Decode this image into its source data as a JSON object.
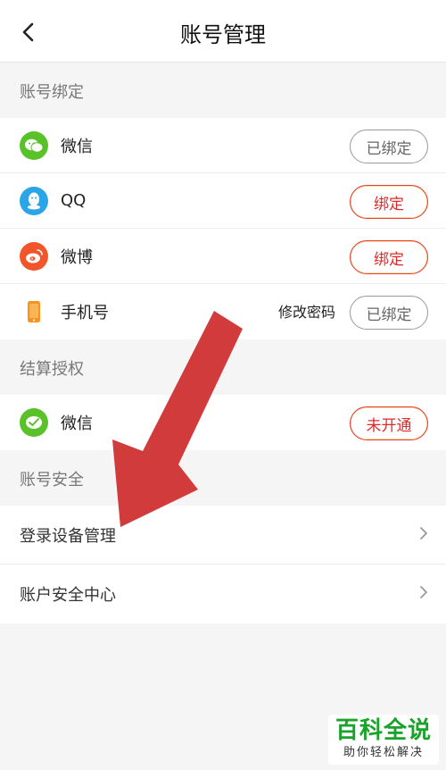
{
  "header": {
    "title": "账号管理",
    "back_icon": "chevron-left-icon"
  },
  "sections": {
    "binding": {
      "title": "账号绑定",
      "items": [
        {
          "label": "微信",
          "icon": "wechat-icon",
          "button": "已绑定",
          "style": "gray"
        },
        {
          "label": "QQ",
          "icon": "qq-icon",
          "button": "绑定",
          "style": "red"
        },
        {
          "label": "微博",
          "icon": "weibo-icon",
          "button": "绑定",
          "style": "red"
        },
        {
          "label": "手机号",
          "icon": "phone-icon",
          "button": "已绑定",
          "style": "gray",
          "extra_link": "修改密码"
        }
      ]
    },
    "settlement": {
      "title": "结算授权",
      "items": [
        {
          "label": "微信",
          "icon": "wechat-pay-icon",
          "button": "未开通",
          "style": "red"
        }
      ]
    },
    "security": {
      "title": "账号安全",
      "items": [
        {
          "label": "登录设备管理"
        },
        {
          "label": "账户安全中心"
        }
      ]
    }
  },
  "watermark": {
    "main": "百科全说",
    "sub": "助你轻松解决"
  },
  "colors": {
    "accent_red": "#e02a2a",
    "wechat_green": "#5ac229",
    "qq_blue": "#2aa5e8",
    "weibo_orange": "#f0562a",
    "phone_orange": "#f7931e",
    "arrow_red": "#d23b3b"
  }
}
